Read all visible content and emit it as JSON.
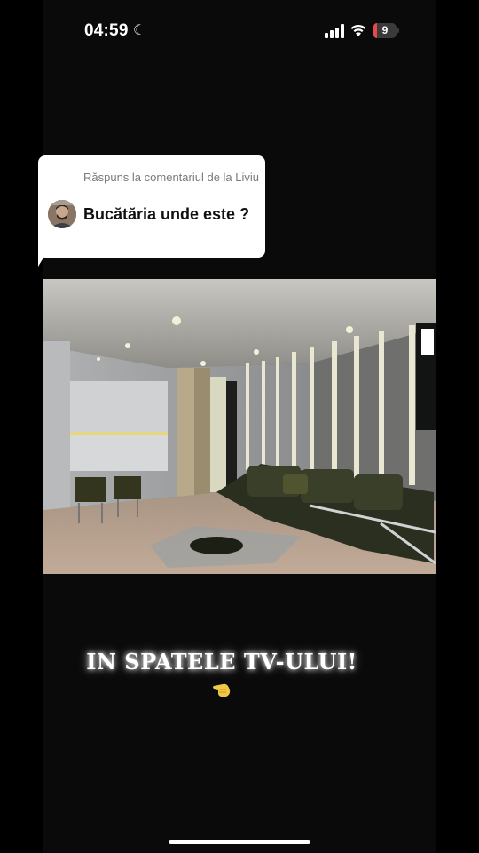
{
  "status_bar": {
    "time": "04:59",
    "battery_level": "9",
    "battery_color": "#e5484d",
    "icons": [
      "moon-icon",
      "cellular-signal-icon",
      "wifi-icon",
      "battery-icon"
    ]
  },
  "reply_card": {
    "label": "Răspuns la comentariul de la Liviu",
    "comment": "Bucătăria unde este ?",
    "background": "#ffffff"
  },
  "caption": {
    "text": "IN SPATELE TV-ULUI!",
    "emoji_icon": "pointing-hand-icon"
  },
  "colors": {
    "background": "#0a0a0a",
    "text": "#ffffff"
  }
}
